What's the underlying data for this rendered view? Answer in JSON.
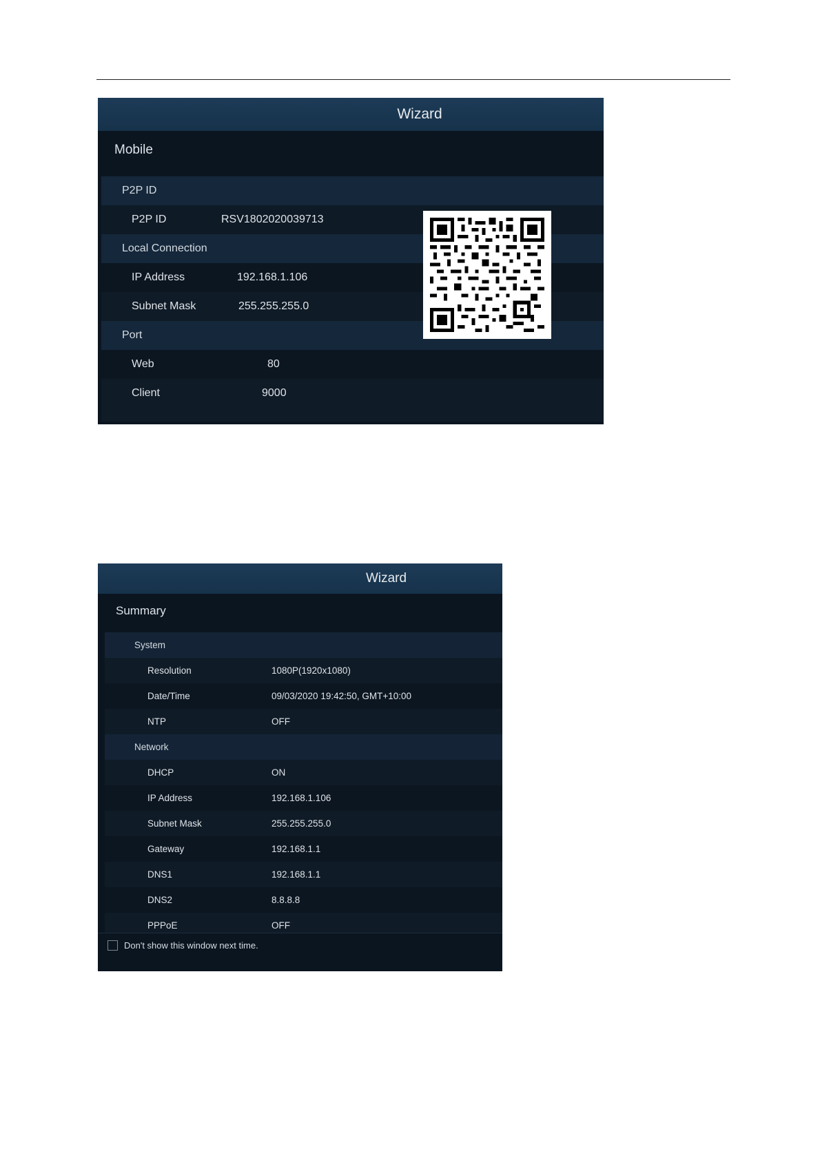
{
  "wizard1": {
    "title": "Wizard",
    "section": "Mobile",
    "rows": [
      {
        "type": "group",
        "label": "P2P ID"
      },
      {
        "type": "item",
        "label": "P2P ID",
        "value": "RSV1802020039713"
      },
      {
        "type": "group",
        "label": "Local Connection"
      },
      {
        "type": "item",
        "label": "IP Address",
        "value": "192.168.1.106"
      },
      {
        "type": "item",
        "label": "Subnet Mask",
        "value": "255.255.255.0"
      },
      {
        "type": "group",
        "label": "Port"
      },
      {
        "type": "item",
        "label": "Web",
        "value": "80"
      },
      {
        "type": "item",
        "label": "Client",
        "value": "9000"
      }
    ],
    "qr_icon": "qr-code"
  },
  "wizard2": {
    "title": "Wizard",
    "section": "Summary",
    "rows": [
      {
        "type": "group",
        "label": "System"
      },
      {
        "type": "item",
        "label": "Resolution",
        "value": "1080P(1920x1080)"
      },
      {
        "type": "item",
        "label": "Date/Time",
        "value": "09/03/2020 19:42:50, GMT+10:00"
      },
      {
        "type": "item",
        "label": "NTP",
        "value": "OFF"
      },
      {
        "type": "group",
        "label": "Network"
      },
      {
        "type": "item",
        "label": "DHCP",
        "value": "ON"
      },
      {
        "type": "item",
        "label": "IP Address",
        "value": "192.168.1.106"
      },
      {
        "type": "item",
        "label": "Subnet Mask",
        "value": "255.255.255.0"
      },
      {
        "type": "item",
        "label": "Gateway",
        "value": "192.168.1.1"
      },
      {
        "type": "item",
        "label": "DNS1",
        "value": "192.168.1.1"
      },
      {
        "type": "item",
        "label": "DNS2",
        "value": "8.8.8.8"
      },
      {
        "type": "item",
        "label": "PPPoE",
        "value": "OFF"
      }
    ],
    "dont_show_label": "Don't show this window next time."
  }
}
